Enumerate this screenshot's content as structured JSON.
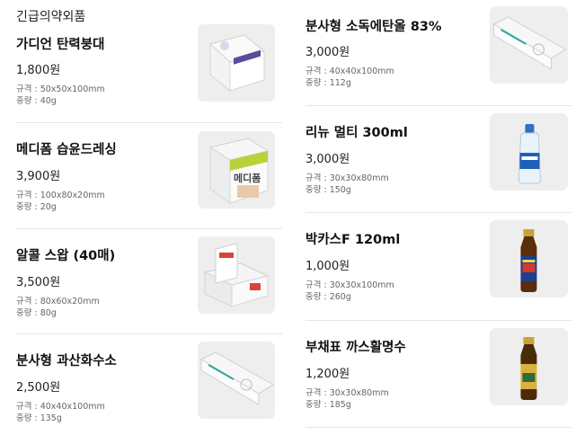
{
  "section": {
    "title": "긴급의약외품"
  },
  "left": [
    {
      "name": "가디언 탄력붕대",
      "price": "1,800원",
      "size": "규격 : 50x50x100mm",
      "weight": "중량 : 40g",
      "icon": "bandage-box-icon"
    },
    {
      "name": "메디폼 습윤드레싱",
      "price": "3,900원",
      "size": "규격 : 100x80x20mm",
      "weight": "중량 : 20g",
      "icon": "dressing-box-icon"
    },
    {
      "name": "알콜 스왑 (40매)",
      "price": "3,500원",
      "size": "규격 : 80x60x20mm",
      "weight": "중량 : 80g",
      "icon": "swab-box-icon"
    },
    {
      "name": "분사형 과산화수소",
      "price": "2,500원",
      "size": "규격 : 40x40x100mm",
      "weight": "중량 : 135g",
      "icon": "spray-box-icon"
    }
  ],
  "right": [
    {
      "name": "분사형 소독에탄올 83%",
      "price": "3,000원",
      "size": "규격 : 40x40x100mm",
      "weight": "중량 : 112g",
      "icon": "spray-box-icon"
    },
    {
      "name": "리뉴 멀티 300ml",
      "price": "3,000원",
      "size": "규격 : 30x30x80mm",
      "weight": "중량 : 150g",
      "icon": "lens-solution-bottle-icon"
    },
    {
      "name": "박카스F 120ml",
      "price": "1,000원",
      "size": "규격 : 30x30x100mm",
      "weight": "중량 : 260g",
      "icon": "energy-drink-bottle-icon"
    },
    {
      "name": "부채표 까스활명수",
      "price": "1,200원",
      "size": "규격 : 30x30x80mm",
      "weight": "중량 : 185g",
      "icon": "digestive-tonic-bottle-icon"
    }
  ],
  "colors": {
    "thumb_bg": "#ececec",
    "divider": "#e6e6e6",
    "spec_text": "#666666"
  }
}
